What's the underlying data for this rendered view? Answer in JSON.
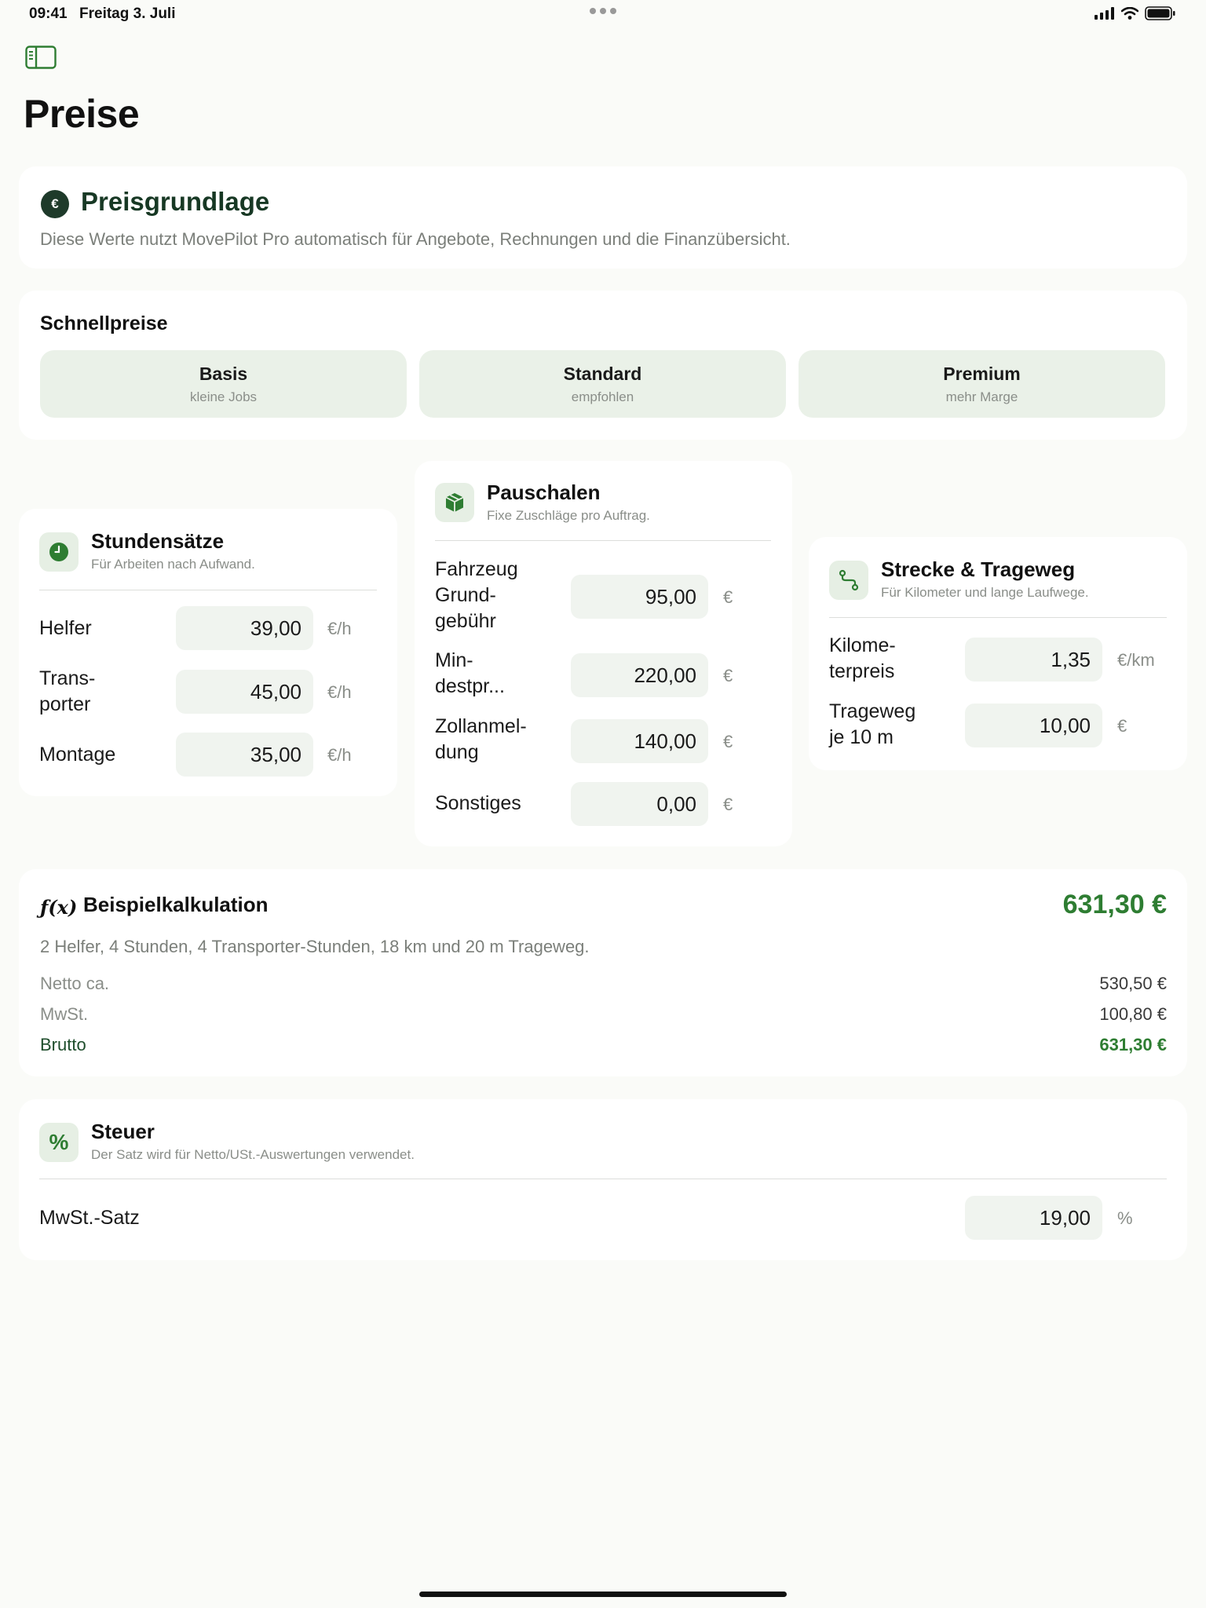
{
  "status_bar": {
    "time": "09:41",
    "date": "Freitag 3. Juli"
  },
  "page": {
    "title": "Preise"
  },
  "preisgrundlage": {
    "icon_glyph": "€",
    "title": "Preisgrundlage",
    "description": "Diese Werte nutzt MovePilot Pro automatisch für Angebote, Rechnungen und die Finanzübersicht."
  },
  "schnellpreise": {
    "title": "Schnellpreise",
    "options": [
      {
        "label": "Basis",
        "sub": "kleine Jobs"
      },
      {
        "label": "Standard",
        "sub": "empfohlen"
      },
      {
        "label": "Premium",
        "sub": "mehr Marge"
      }
    ]
  },
  "stundensaetze": {
    "title": "Stundensätze",
    "subtitle": "Für Arbeiten nach Aufwand.",
    "rows": [
      {
        "label": "Helfer",
        "value": "39,00",
        "unit": "€/h"
      },
      {
        "label": "Trans-\nporter",
        "value": "45,00",
        "unit": "€/h"
      },
      {
        "label": "Montage",
        "value": "35,00",
        "unit": "€/h"
      }
    ]
  },
  "pauschalen": {
    "title": "Pauschalen",
    "subtitle": "Fixe Zuschläge pro Auftrag.",
    "rows": [
      {
        "label": "Fahrzeug\nGrund-\ngebühr",
        "value": "95,00",
        "unit": "€"
      },
      {
        "label": "Min-\ndestpr...",
        "value": "220,00",
        "unit": "€"
      },
      {
        "label": "Zollanmel-\ndung",
        "value": "140,00",
        "unit": "€"
      },
      {
        "label": "Sonstiges",
        "value": "0,00",
        "unit": "€"
      }
    ]
  },
  "strecke": {
    "title": "Strecke & Trageweg",
    "subtitle": "Für Kilometer und lange Laufwege.",
    "rows": [
      {
        "label": "Kilome-\nterpreis",
        "value": "1,35",
        "unit": "€/km"
      },
      {
        "label": "Trageweg\nje 10 m",
        "value": "10,00",
        "unit": "€"
      }
    ]
  },
  "beispiel": {
    "fx": "ƒ(x)",
    "title": "Beispielkalkulation",
    "total": "631,30 €",
    "description": "2 Helfer, 4 Stunden, 4 Transporter-Stunden, 18 km und 20 m Trageweg.",
    "lines": [
      {
        "label": "Netto ca.",
        "value": "530,50 €"
      },
      {
        "label": "MwSt.",
        "value": "100,80 €"
      },
      {
        "label": "Brutto",
        "value": "631,30 €"
      }
    ]
  },
  "steuer": {
    "icon_glyph": "%",
    "title": "Steuer",
    "subtitle": "Der Satz wird für Netto/USt.-Auswertungen verwendet.",
    "row": {
      "label": "MwSt.-Satz",
      "value": "19,00",
      "unit": "%"
    }
  },
  "colors": {
    "accent_green": "#2e7d32",
    "dark_green": "#173824",
    "chip_bg": "#eaf1e8"
  }
}
